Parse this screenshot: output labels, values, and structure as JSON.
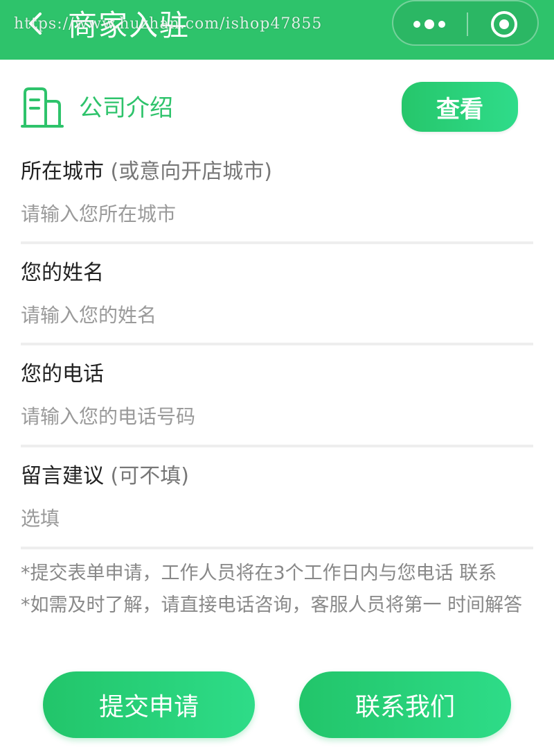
{
  "nav": {
    "title": "商家入驻",
    "watermark": "https://www.huzhan.com/ishop47855"
  },
  "section": {
    "title": "公司介绍",
    "view_button": "查看"
  },
  "form": {
    "fields": [
      {
        "label": "所在城市",
        "hint": "(或意向开店城市)",
        "placeholder": "请输入您所在城市"
      },
      {
        "label": "您的姓名",
        "hint": "",
        "placeholder": "请输入您的姓名"
      },
      {
        "label": "您的电话",
        "hint": "",
        "placeholder": "请输入您的电话号码"
      },
      {
        "label": "留言建议",
        "hint": "(可不填)",
        "placeholder": "选填"
      }
    ]
  },
  "notes": [
    "*提交表单申请，工作人员将在3个工作日内与您电话 联系",
    "*如需及时了解，请直接电话咨询，客服人员将第一 时间解答"
  ],
  "buttons": {
    "submit": "提交申请",
    "contact": "联系我们"
  },
  "colors": {
    "brand_green": "#2ec36b",
    "placeholder_gray": "#9a9a9a"
  }
}
